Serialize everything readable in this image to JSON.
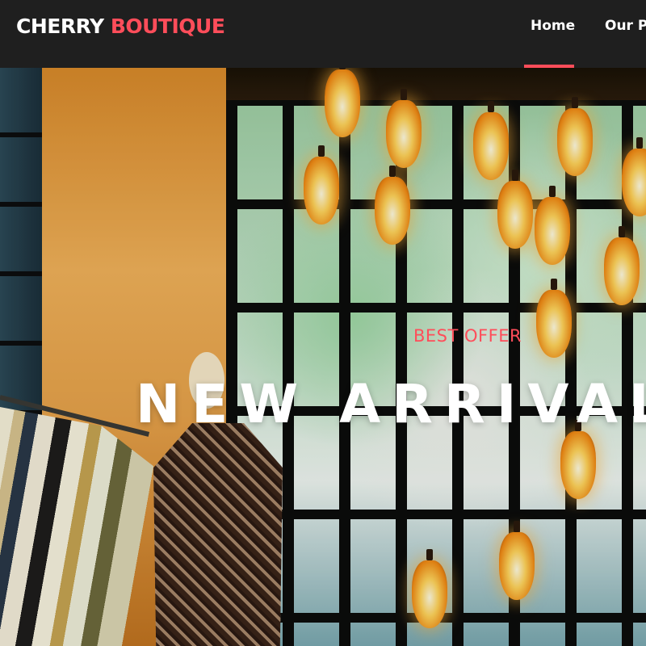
{
  "brand": {
    "part1": "CHERRY",
    "part2": "BOUTIQUE"
  },
  "nav": {
    "items": [
      {
        "label": "Home",
        "active": true
      },
      {
        "label": "Our Pro"
      }
    ]
  },
  "hero": {
    "eyebrow": "BEST OFFER",
    "title": "NEW ARRIVALS ON"
  },
  "colors": {
    "accent": "#ff4d5a",
    "navbar_bg": "#1f1f1f",
    "text_light": "#ffffff"
  }
}
